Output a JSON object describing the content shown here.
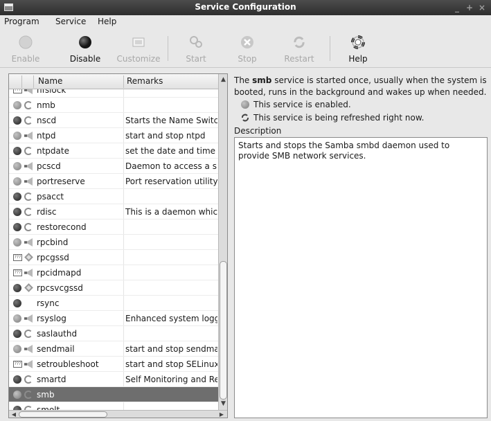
{
  "window": {
    "title": "Service Configuration",
    "buttons": [
      "_",
      "+",
      "×"
    ]
  },
  "menu": [
    "Program",
    "Service",
    "Help"
  ],
  "toolbar": [
    {
      "label": "Enable",
      "icon": "enable-icon",
      "enabled": false
    },
    {
      "label": "Disable",
      "icon": "disable-icon",
      "enabled": true
    },
    {
      "label": "Customize",
      "icon": "customize-icon",
      "enabled": false
    },
    {
      "label": "Start",
      "icon": "start-icon",
      "enabled": false
    },
    {
      "label": "Stop",
      "icon": "stop-icon",
      "enabled": false
    },
    {
      "label": "Restart",
      "icon": "restart-icon",
      "enabled": false
    },
    {
      "label": "Help",
      "icon": "help-icon",
      "enabled": true
    }
  ],
  "list": {
    "columns": [
      "Name",
      "Remarks"
    ],
    "rows": [
      {
        "name": "nfslock",
        "remark": "",
        "status": "unknown",
        "runtime": "speaker"
      },
      {
        "name": "nmb",
        "remark": "",
        "status": "disabled",
        "runtime": "spin"
      },
      {
        "name": "nscd",
        "remark": "Starts the Name Switc",
        "status": "enabled",
        "runtime": "spin"
      },
      {
        "name": "ntpd",
        "remark": "start and stop ntpd",
        "status": "disabled",
        "runtime": "speaker"
      },
      {
        "name": "ntpdate",
        "remark": "set the date and time",
        "status": "enabled",
        "runtime": "spin"
      },
      {
        "name": "pcscd",
        "remark": "Daemon to access a s",
        "status": "disabled",
        "runtime": "speaker"
      },
      {
        "name": "portreserve",
        "remark": "Port reservation utility",
        "status": "disabled",
        "runtime": "speaker"
      },
      {
        "name": "psacct",
        "remark": "",
        "status": "enabled",
        "runtime": "spin"
      },
      {
        "name": "rdisc",
        "remark": "This is a daemon which",
        "status": "enabled",
        "runtime": "spin"
      },
      {
        "name": "restorecond",
        "remark": "",
        "status": "enabled",
        "runtime": "spin"
      },
      {
        "name": "rpcbind",
        "remark": "",
        "status": "disabled",
        "runtime": "speaker"
      },
      {
        "name": "rpcgssd",
        "remark": "",
        "status": "unknown",
        "runtime": "diamond"
      },
      {
        "name": "rpcidmapd",
        "remark": "",
        "status": "unknown",
        "runtime": "speaker"
      },
      {
        "name": "rpcsvcgssd",
        "remark": "",
        "status": "enabled",
        "runtime": "diamond"
      },
      {
        "name": "rsync",
        "remark": "",
        "status": "enabled",
        "runtime": "none"
      },
      {
        "name": "rsyslog",
        "remark": "Enhanced system logg",
        "status": "disabled",
        "runtime": "speaker"
      },
      {
        "name": "saslauthd",
        "remark": "",
        "status": "enabled",
        "runtime": "spin"
      },
      {
        "name": "sendmail",
        "remark": "start and stop sendma",
        "status": "disabled",
        "runtime": "speaker"
      },
      {
        "name": "setroubleshoot",
        "remark": "start and stop SELinux",
        "status": "unknown",
        "runtime": "speaker"
      },
      {
        "name": "smartd",
        "remark": "Self Monitoring and Re",
        "status": "enabled",
        "runtime": "spin"
      },
      {
        "name": "smb",
        "remark": "",
        "status": "disabled",
        "runtime": "spin",
        "selected": true
      },
      {
        "name": "smolt",
        "remark": "",
        "status": "enabled",
        "runtime": "spin"
      }
    ]
  },
  "details": {
    "intro_pre": "The ",
    "service": "smb",
    "intro_post": " service is started once, usually when the system is booted, runs in the background and wakes up when needed.",
    "enabled_text": "This service is enabled.",
    "refreshed_text": "This service is being refreshed right now.",
    "description_label": "Description",
    "description": "Starts and stops the Samba smbd daemon used to provide SMB network services."
  },
  "colors": {
    "selected_row": "#6e6e6e",
    "titlebar": "#3a3a3a"
  }
}
